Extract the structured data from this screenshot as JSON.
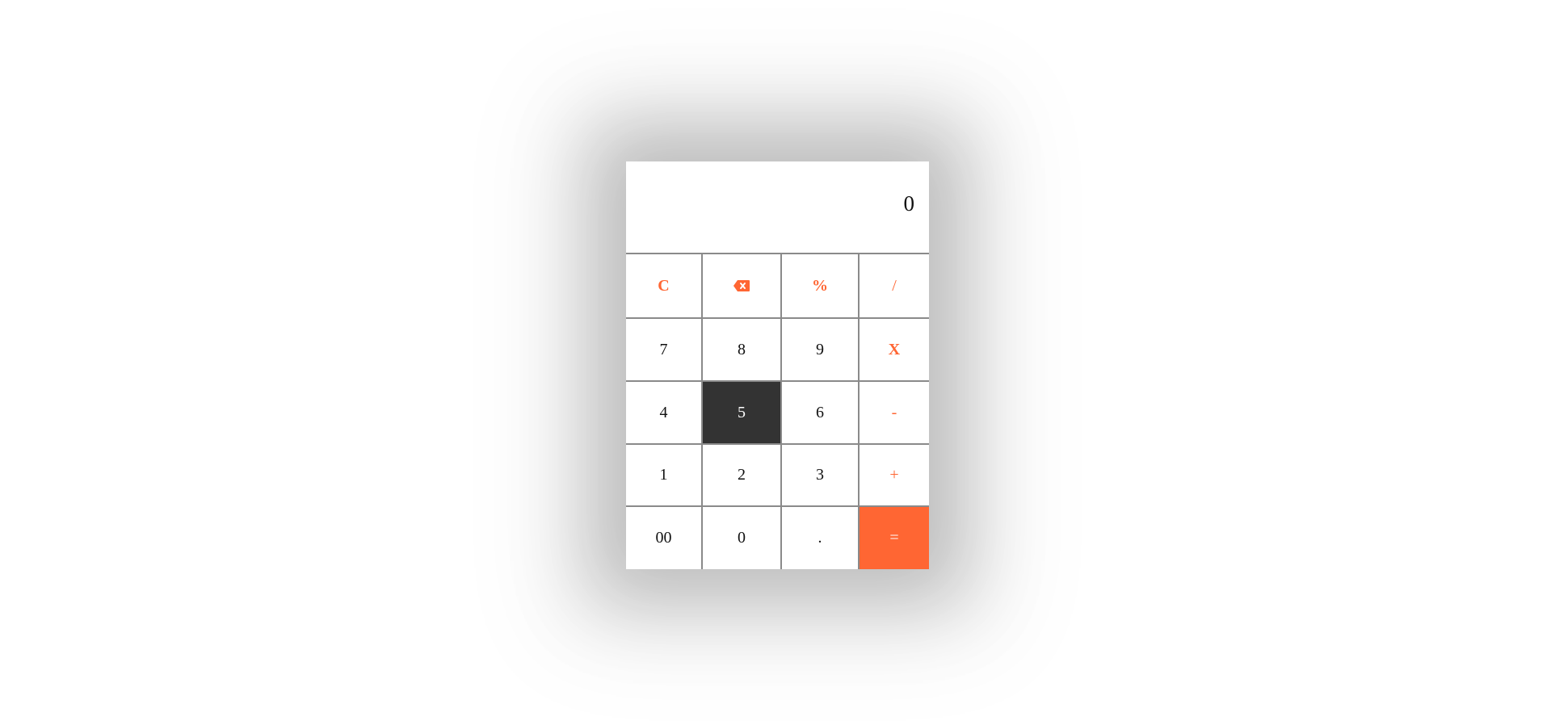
{
  "colors": {
    "accent": "#ff6633",
    "active_key": "#333333",
    "border": "#8a8a8a"
  },
  "display": {
    "value": "0"
  },
  "keys": {
    "clear": "C",
    "backspace_icon": "backspace-icon",
    "percent": "%",
    "divide": "/",
    "seven": "7",
    "eight": "8",
    "nine": "9",
    "multiply": "X",
    "four": "4",
    "five": "5",
    "six": "6",
    "minus": "-",
    "one": "1",
    "two": "2",
    "three": "3",
    "plus": "+",
    "double_zero": "00",
    "zero": "0",
    "decimal": ".",
    "equals": "="
  }
}
